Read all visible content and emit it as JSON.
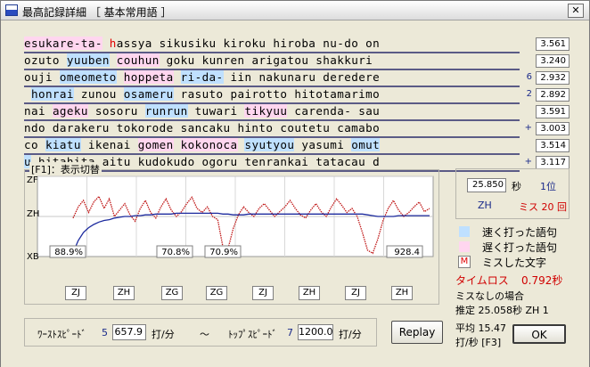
{
  "window": {
    "title": "最高記録詳細 ［ 基本常用語 ］",
    "close_glyph": "✕"
  },
  "typing_lines": [
    {
      "segments": [
        {
          "t": "esukare-ta-",
          "k": "slow"
        },
        {
          "t": " ",
          "k": ""
        },
        {
          "t": "h",
          "k": "miss"
        },
        {
          "t": "assya sikusiku kiroku hiroba nu-do on",
          "k": ""
        }
      ],
      "mark": "",
      "time": "3.561"
    },
    {
      "segments": [
        {
          "t": "ozuto ",
          "k": ""
        },
        {
          "t": "yuuben",
          "k": "fast"
        },
        {
          "t": " ",
          "k": ""
        },
        {
          "t": "couhun",
          "k": "slow"
        },
        {
          "t": " goku kunren arigatou shakkuri ",
          "k": ""
        }
      ],
      "mark": "",
      "time": "3.240"
    },
    {
      "segments": [
        {
          "t": "ouji ",
          "k": ""
        },
        {
          "t": "omeometo",
          "k": "fast"
        },
        {
          "t": " ",
          "k": ""
        },
        {
          "t": "hoppeta",
          "k": "slow"
        },
        {
          "t": " ",
          "k": ""
        },
        {
          "t": "ri-da-",
          "k": "fast"
        },
        {
          "t": " iin nakunaru deredere",
          "k": ""
        }
      ],
      "mark": "6",
      "time": "2.932"
    },
    {
      "segments": [
        {
          "t": " ",
          "k": ""
        },
        {
          "t": "honrai",
          "k": "fast"
        },
        {
          "t": " zunou ",
          "k": ""
        },
        {
          "t": "osameru",
          "k": "fast"
        },
        {
          "t": " rasuto pairotto hitotamarimo",
          "k": ""
        }
      ],
      "mark": "2",
      "time": "2.892"
    },
    {
      "segments": [
        {
          "t": "nai ",
          "k": ""
        },
        {
          "t": "ageku",
          "k": "slow"
        },
        {
          "t": " sosoru ",
          "k": ""
        },
        {
          "t": "runrun",
          "k": "fast"
        },
        {
          "t": " tuwari ",
          "k": ""
        },
        {
          "t": "tikyuu",
          "k": "slow"
        },
        {
          "t": " carenda- sau",
          "k": ""
        }
      ],
      "mark": "",
      "time": "3.591"
    },
    {
      "segments": [
        {
          "t": "ndo darakeru tokorode sancaku hinto coutetu camabo",
          "k": ""
        }
      ],
      "mark": "+",
      "time": "3.003"
    },
    {
      "segments": [
        {
          "t": "co ",
          "k": ""
        },
        {
          "t": "kiatu",
          "k": "fast"
        },
        {
          "t": " ikenai ",
          "k": ""
        },
        {
          "t": "gomen",
          "k": "slow"
        },
        {
          "t": " ",
          "k": ""
        },
        {
          "t": "kokonoca",
          "k": "slow"
        },
        {
          "t": " ",
          "k": ""
        },
        {
          "t": "syutyou",
          "k": "fast"
        },
        {
          "t": " yasumi ",
          "k": ""
        },
        {
          "t": "omut",
          "k": "fast"
        }
      ],
      "mark": "",
      "time": "3.514"
    },
    {
      "segments": [
        {
          "t": "u",
          "k": "fast"
        },
        {
          "t": " hitahita aitu kudokudo ogoru tenrankai tatacau d",
          "k": ""
        }
      ],
      "mark": "+",
      "time": "3.117"
    }
  ],
  "graph": {
    "caption": "[F1]：表示切替",
    "ylabels": [
      "ZF",
      "ZH",
      "XB"
    ],
    "readouts": [
      "88.9%",
      "70.8%",
      "70.9%",
      "928.4"
    ],
    "rank_buttons": [
      "ZJ",
      "ZH",
      "ZG",
      "ZG",
      "ZJ",
      "ZH",
      "ZJ",
      "ZH"
    ],
    "red_series": [
      0.48,
      0.62,
      0.7,
      0.55,
      0.68,
      0.75,
      0.6,
      0.72,
      0.5,
      0.58,
      0.66,
      0.52,
      0.44,
      0.6,
      0.7,
      0.55,
      0.48,
      0.62,
      0.72,
      0.58,
      0.5,
      0.56,
      0.66,
      0.74,
      0.6,
      0.55,
      0.62,
      0.5,
      0.46,
      0.12,
      0.1,
      0.35,
      0.52,
      0.62,
      0.55,
      0.5,
      0.6,
      0.66,
      0.58,
      0.5,
      0.56,
      0.62,
      0.7,
      0.6,
      0.52,
      0.48,
      0.58,
      0.66,
      0.56,
      0.5,
      0.62,
      0.72,
      0.64,
      0.55,
      0.6,
      0.5,
      0.3,
      0.08,
      0.04,
      0.22,
      0.45,
      0.6,
      0.7,
      0.58,
      0.5,
      0.55,
      0.62,
      0.68,
      0.56,
      0.6
    ],
    "blue_series": [
      0.05,
      0.2,
      0.3,
      0.36,
      0.4,
      0.43,
      0.45,
      0.46,
      0.48,
      0.49,
      0.5,
      0.5,
      0.51,
      0.51,
      0.52,
      0.52,
      0.53,
      0.53,
      0.53,
      0.53,
      0.54,
      0.54,
      0.54,
      0.54,
      0.54,
      0.54,
      0.54,
      0.54,
      0.54,
      0.53,
      0.53,
      0.52,
      0.52,
      0.52,
      0.53,
      0.53,
      0.53,
      0.53,
      0.53,
      0.53,
      0.53,
      0.53,
      0.53,
      0.53,
      0.53,
      0.53,
      0.53,
      0.53,
      0.53,
      0.53,
      0.53,
      0.53,
      0.53,
      0.53,
      0.53,
      0.53,
      0.53,
      0.52,
      0.51,
      0.5,
      0.5,
      0.5,
      0.5,
      0.51,
      0.51,
      0.51,
      0.51,
      0.51,
      0.51,
      0.51
    ]
  },
  "speeds": {
    "worst_label": "ﾜｰｽﾄｽﾋﾟｰﾄﾞ",
    "worst_rank": "5",
    "worst_value": "657.9",
    "worst_unit": "打/分",
    "tilde": "～",
    "top_label": "ﾄｯﾌﾟｽﾋﾟｰﾄﾞ",
    "top_rank": "7",
    "top_value": "1200.0",
    "top_unit": "打/分"
  },
  "buttons": {
    "replay": "Replay",
    "ok": "OK"
  },
  "record": {
    "time_value": "25.850",
    "time_unit": "秒",
    "rank": "1位",
    "grade": "ZH",
    "miss_label": "ミス 20 回"
  },
  "legend": {
    "fast": "速く打った語句",
    "slow": "遅く打った語句",
    "miss_box": "M",
    "miss": "ミスした文字",
    "timeloss": "タイムロス",
    "timeloss_value": "0.792秒",
    "no_miss_label": "ミスなしの場合",
    "estimate": "推定  25.058秒 ZH  1",
    "average": "平均 15.47",
    "average_unit": "打/秒 [F3]"
  },
  "colors": {
    "fast": "#bfe0ff",
    "slow": "#ffd6ef",
    "miss": "#e00000",
    "red_series": "#c01818",
    "blue_series": "#1c2a9e"
  }
}
